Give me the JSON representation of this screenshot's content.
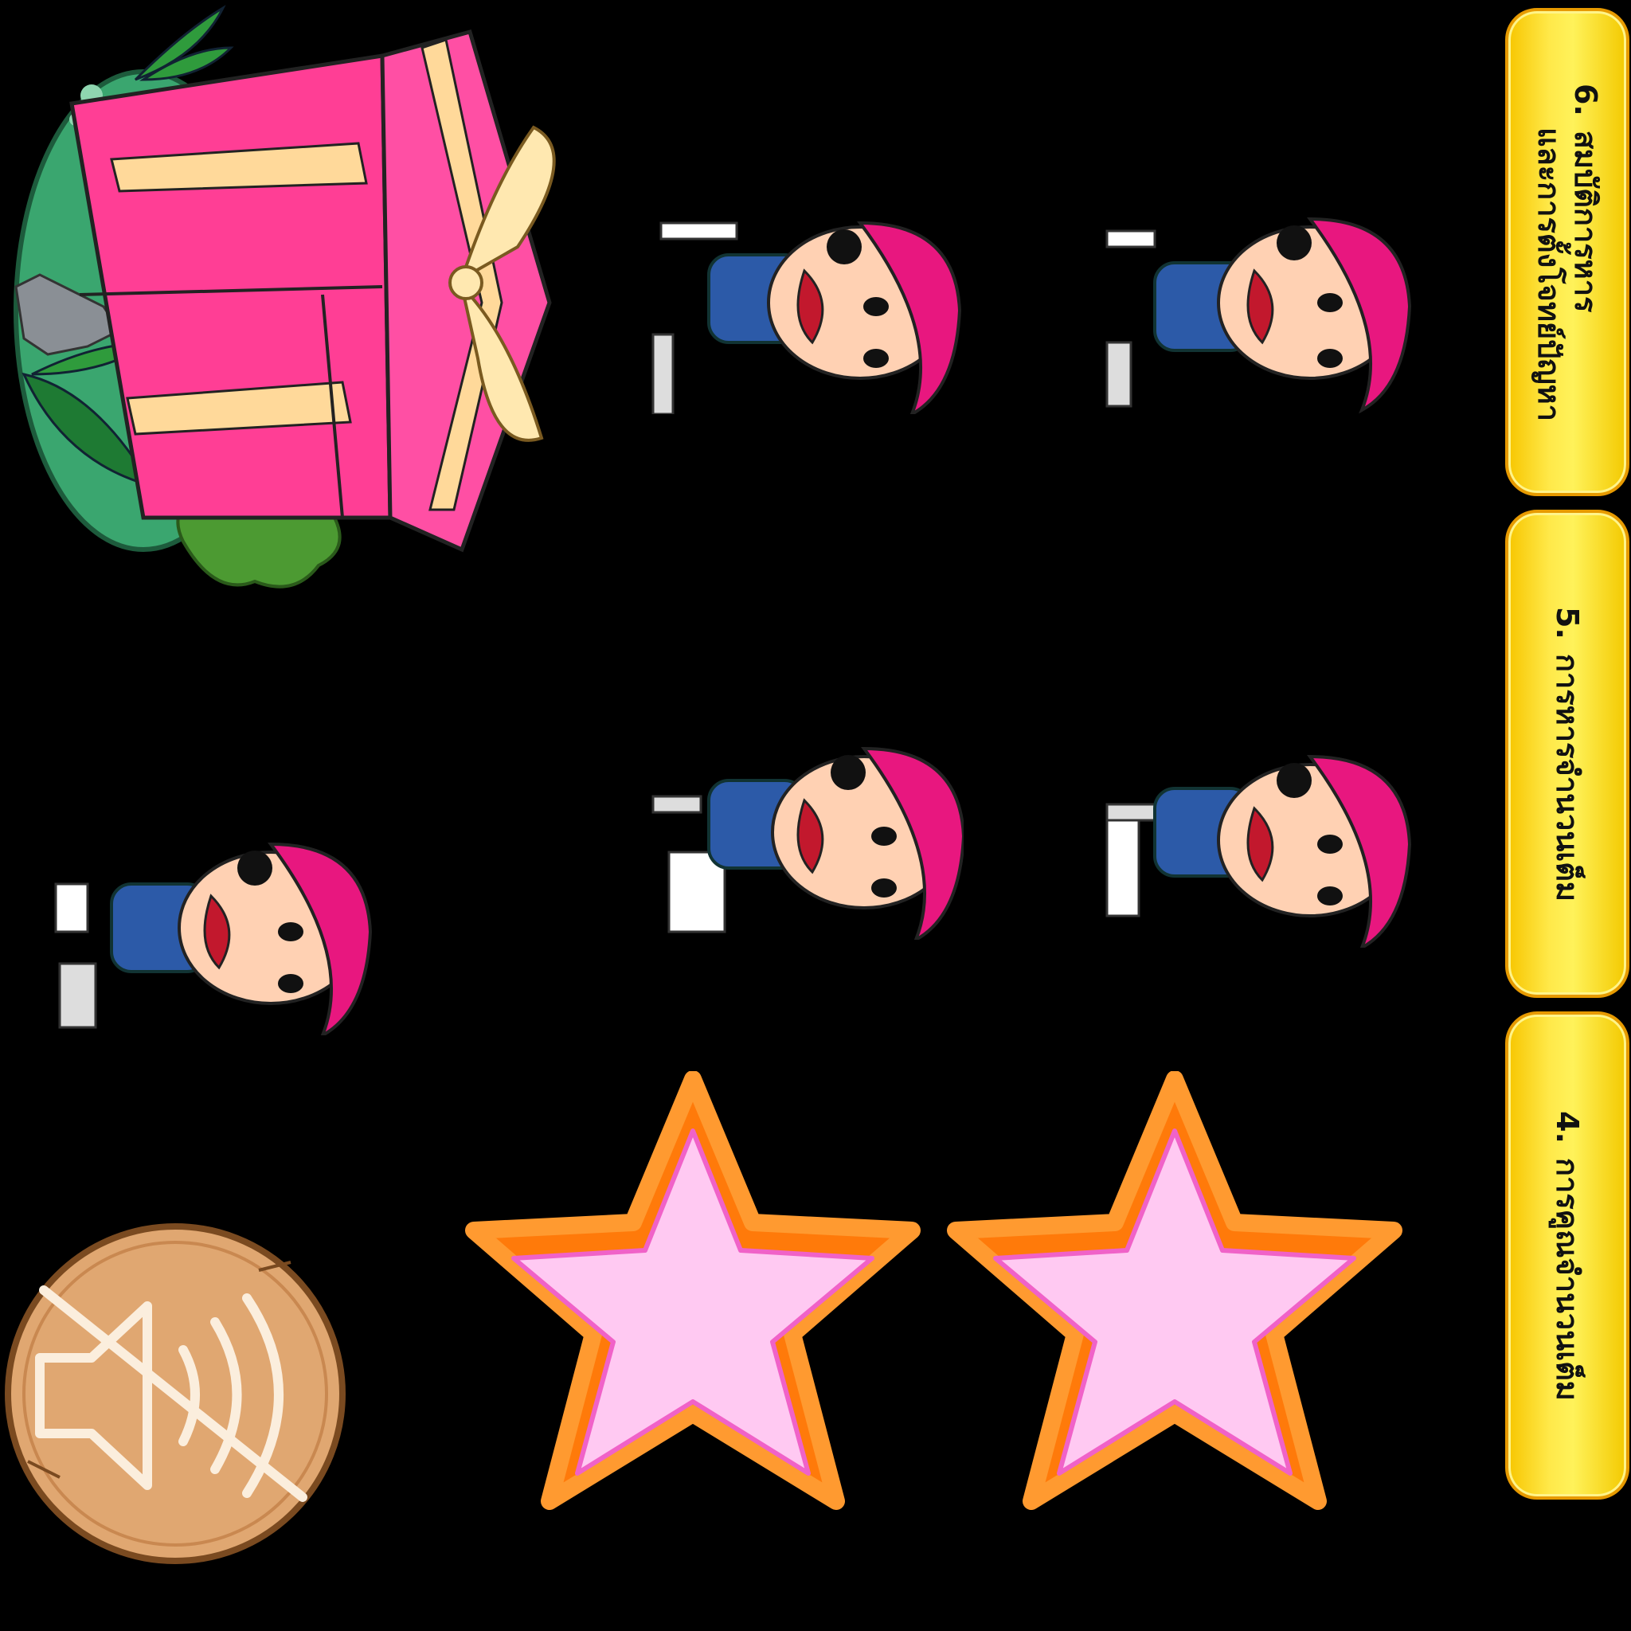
{
  "menu_buttons": [
    {
      "number": "6.",
      "line1": "สมบัติการหาร",
      "line2": "และการตั้งโจทย์ปัญหา"
    },
    {
      "number": "5.",
      "line1": "การหารจำนวนเต็ม",
      "line2": ""
    },
    {
      "number": "4.",
      "line1": "การคูณจำนวนเต็ม",
      "line2": ""
    }
  ],
  "icons": {
    "gift": "gift-box-icon",
    "character": "boy-pink-helmet-character",
    "star": "star-icon",
    "sound": "sound-muted-icon"
  },
  "colors": {
    "button_yellow": "#ffe94a",
    "button_border": "#e79a00",
    "star_outer": "#ff7a0a",
    "star_inner": "#ffc9f2",
    "gift_pink": "#ff3e95",
    "sound_wood": "#e0a771"
  }
}
